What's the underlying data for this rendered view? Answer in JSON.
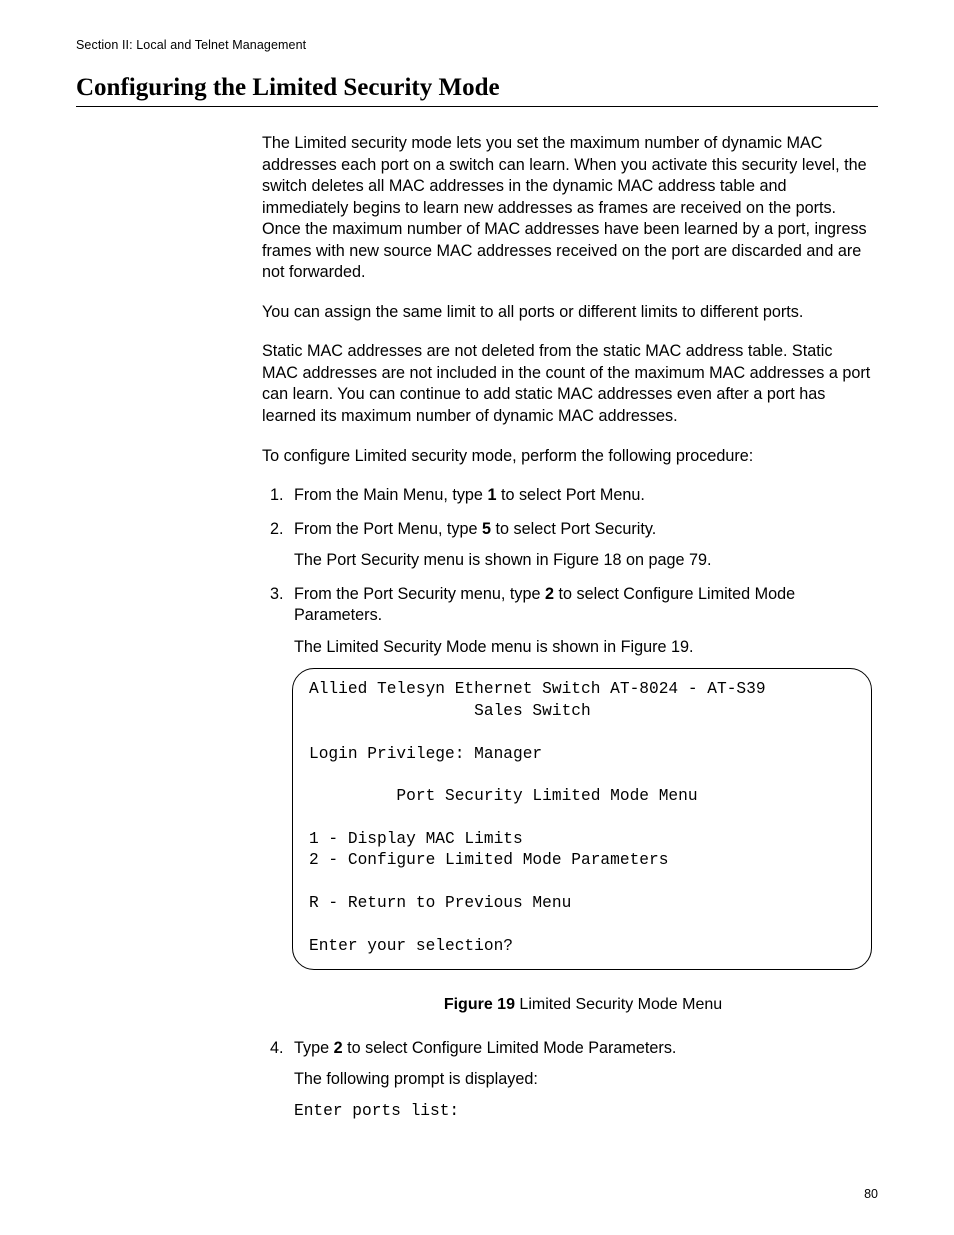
{
  "header": "Section II: Local and Telnet Management",
  "title": "Configuring the Limited Security Mode",
  "para1": "The Limited security mode lets you set the maximum number of dynamic MAC addresses each port on a switch can learn. When you activate this security level, the switch deletes all MAC addresses in the dynamic MAC address table and immediately begins to learn new addresses as frames are received on the ports. Once the maximum number of MAC addresses have been learned by a port, ingress frames with new source MAC addresses received on the port are discarded and are not forwarded.",
  "para2": "You can assign the same limit to all ports or different limits to different ports.",
  "para3": "Static MAC addresses are not deleted from the static MAC address table. Static MAC addresses are not included in the count of the maximum MAC addresses a port can learn. You can continue to add static MAC addresses even after a port has learned its maximum number of dynamic MAC addresses.",
  "para4": "To configure Limited security mode, perform the following procedure:",
  "steps": {
    "s1a": "From the Main Menu, type ",
    "s1b": "1",
    "s1c": " to select Port Menu.",
    "s2a": "From the Port Menu, type ",
    "s2b": "5",
    "s2c": " to select Port Security.",
    "s2sub": "The Port Security menu is shown in Figure 18 on page 79.",
    "s3a": "From the Port Security menu, type ",
    "s3b": "2",
    "s3c": " to select Configure Limited Mode Parameters.",
    "s3sub": "The Limited Security Mode menu is shown in Figure 19.",
    "s4a": "Type ",
    "s4b": "2",
    "s4c": " to select Configure Limited Mode Parameters.",
    "s4sub": "The following prompt is displayed:",
    "s4prompt": "Enter ports list:"
  },
  "terminal": {
    "l1": "Allied Telesyn Ethernet Switch AT-8024 - AT-S39",
    "l2": "                 Sales Switch",
    "l3": "Login Privilege: Manager",
    "l4": "         Port Security Limited Mode Menu",
    "l5": "1 - Display MAC Limits",
    "l6": "2 - Configure Limited Mode Parameters",
    "l7": "R - Return to Previous Menu",
    "l8": "Enter your selection?"
  },
  "figure": {
    "label": "Figure 19",
    "text": "  Limited Security Mode Menu"
  },
  "pageNumber": "80"
}
